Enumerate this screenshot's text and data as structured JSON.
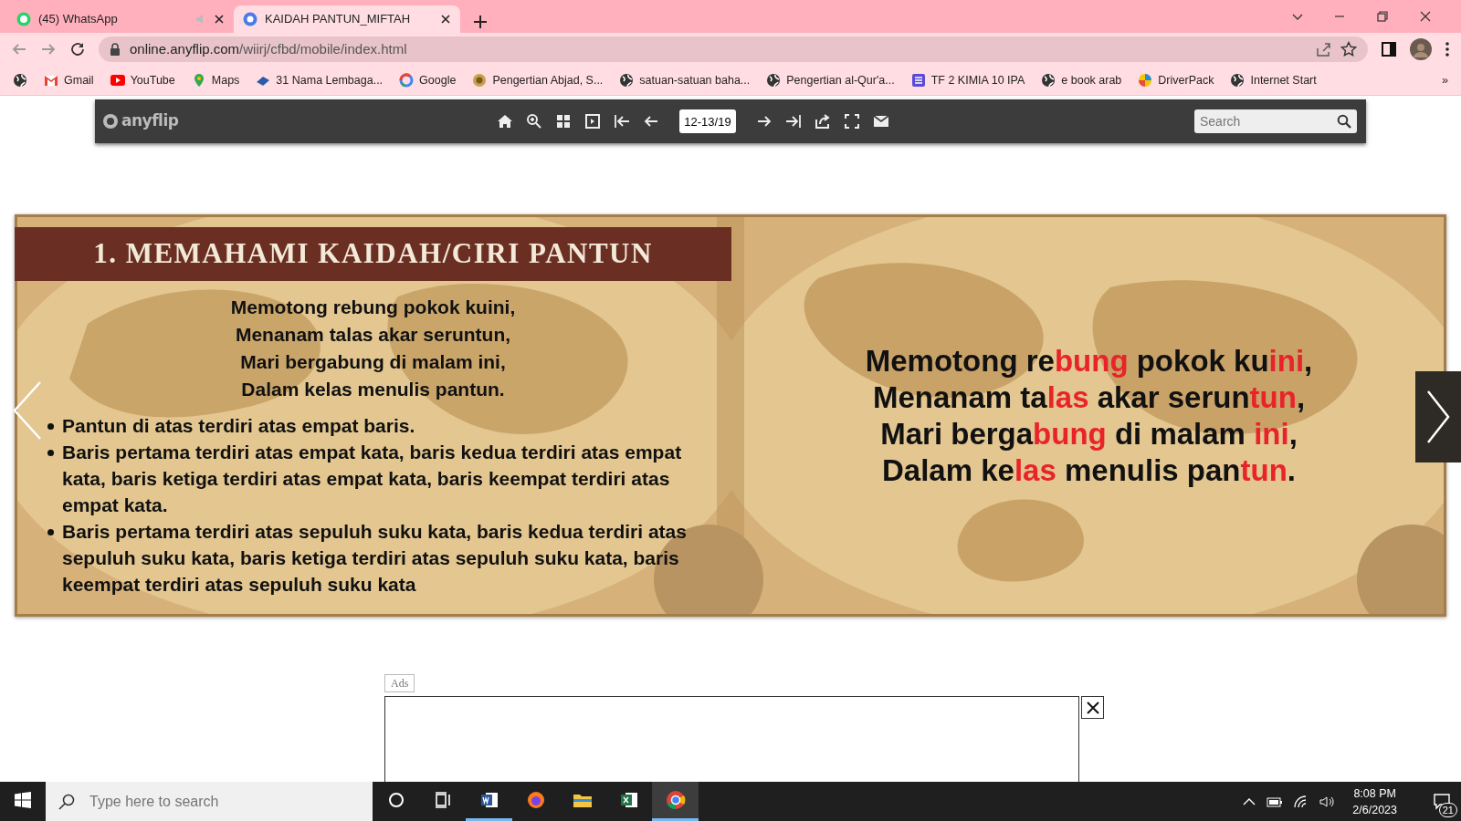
{
  "browser": {
    "tabs": [
      {
        "title": "(45) WhatsApp",
        "kind": "whatsapp",
        "selected": false,
        "muted": true
      },
      {
        "title": "KAIDAH PANTUN_MIFTAH",
        "kind": "anyflip",
        "selected": true,
        "muted": false
      }
    ],
    "address": {
      "domain": "online.anyflip.com",
      "path": "/wiirj/cfbd/mobile/index.html"
    },
    "bookmarks": [
      {
        "kind": "globe"
      },
      {
        "label": "Gmail",
        "kind": "gmail"
      },
      {
        "label": "YouTube",
        "kind": "youtube"
      },
      {
        "label": "Maps",
        "kind": "maps"
      },
      {
        "label": "31 Nama Lembaga...",
        "kind": "book"
      },
      {
        "label": "Google",
        "kind": "google"
      },
      {
        "label": "Pengertian Abjad, S...",
        "kind": "emblem"
      },
      {
        "label": "satuan-satuan baha...",
        "kind": "globe"
      },
      {
        "label": "Pengertian al-Qur'a...",
        "kind": "globe"
      },
      {
        "label": "TF 2 KIMIA 10 IPA",
        "kind": "list"
      },
      {
        "label": "e book arab",
        "kind": "globe"
      },
      {
        "label": "DriverPack",
        "kind": "driverpack"
      },
      {
        "label": "Internet Start",
        "kind": "globe"
      }
    ],
    "bookmarks_more": "»"
  },
  "reader": {
    "logo": "anyflip",
    "page_field": "12-13/19",
    "search": {
      "placeholder": "Search"
    }
  },
  "book": {
    "left_page": {
      "title": "1. MEMAHAMI KAIDAH/CIRI PANTUN",
      "stanza": [
        "Memotong rebung pokok kuini,",
        "Menanam talas akar seruntun,",
        "Mari bergabung di malam ini,",
        "Dalam kelas menulis pantun."
      ],
      "bullets": [
        "Pantun di atas terdiri atas empat baris.",
        "Baris pertama terdiri atas empat kata, baris kedua terdiri atas empat kata, baris ketiga terdiri atas empat kata, baris keempat terdiri atas empat kata.",
        "Baris pertama terdiri atas sepuluh suku kata, baris kedua terdiri atas sepuluh suku kata, baris ketiga terdiri atas sepuluh suku kata, baris keempat terdiri atas sepuluh suku kata"
      ]
    },
    "right_page": {
      "lines": [
        [
          {
            "text": "Memotong re",
            "highlight": false
          },
          {
            "text": "bung",
            "highlight": true
          },
          {
            "text": " pokok ku",
            "highlight": false
          },
          {
            "text": "ini",
            "highlight": true
          },
          {
            "text": ",",
            "highlight": false
          }
        ],
        [
          {
            "text": "Menanam ta",
            "highlight": false
          },
          {
            "text": "las",
            "highlight": true
          },
          {
            "text": " akar serun",
            "highlight": false
          },
          {
            "text": "tun",
            "highlight": true
          },
          {
            "text": ",",
            "highlight": false
          }
        ],
        [
          {
            "text": "Mari berga",
            "highlight": false
          },
          {
            "text": "bung",
            "highlight": true
          },
          {
            "text": " di malam ",
            "highlight": false
          },
          {
            "text": "ini",
            "highlight": true
          },
          {
            "text": ",",
            "highlight": false
          }
        ],
        [
          {
            "text": "Dalam ke",
            "highlight": false
          },
          {
            "text": "las",
            "highlight": true
          },
          {
            "text": " menulis pan",
            "highlight": false
          },
          {
            "text": "tun",
            "highlight": true
          },
          {
            "text": ".",
            "highlight": false
          }
        ]
      ]
    }
  },
  "ad": {
    "label": "Ads"
  },
  "taskbar": {
    "search": {
      "placeholder": "Type here to search"
    },
    "apps": [
      {
        "kind": "cortana",
        "open": false,
        "selected": false
      },
      {
        "kind": "taskview",
        "open": false,
        "selected": false
      },
      {
        "kind": "word",
        "open": true,
        "selected": false
      },
      {
        "kind": "firefox",
        "open": false,
        "selected": false
      },
      {
        "kind": "explorer",
        "open": false,
        "selected": false
      },
      {
        "kind": "excel",
        "open": false,
        "selected": false
      },
      {
        "kind": "chrome",
        "open": true,
        "selected": true
      }
    ],
    "time": "8:08 PM",
    "date": "2/6/2023",
    "notifications": "21"
  }
}
